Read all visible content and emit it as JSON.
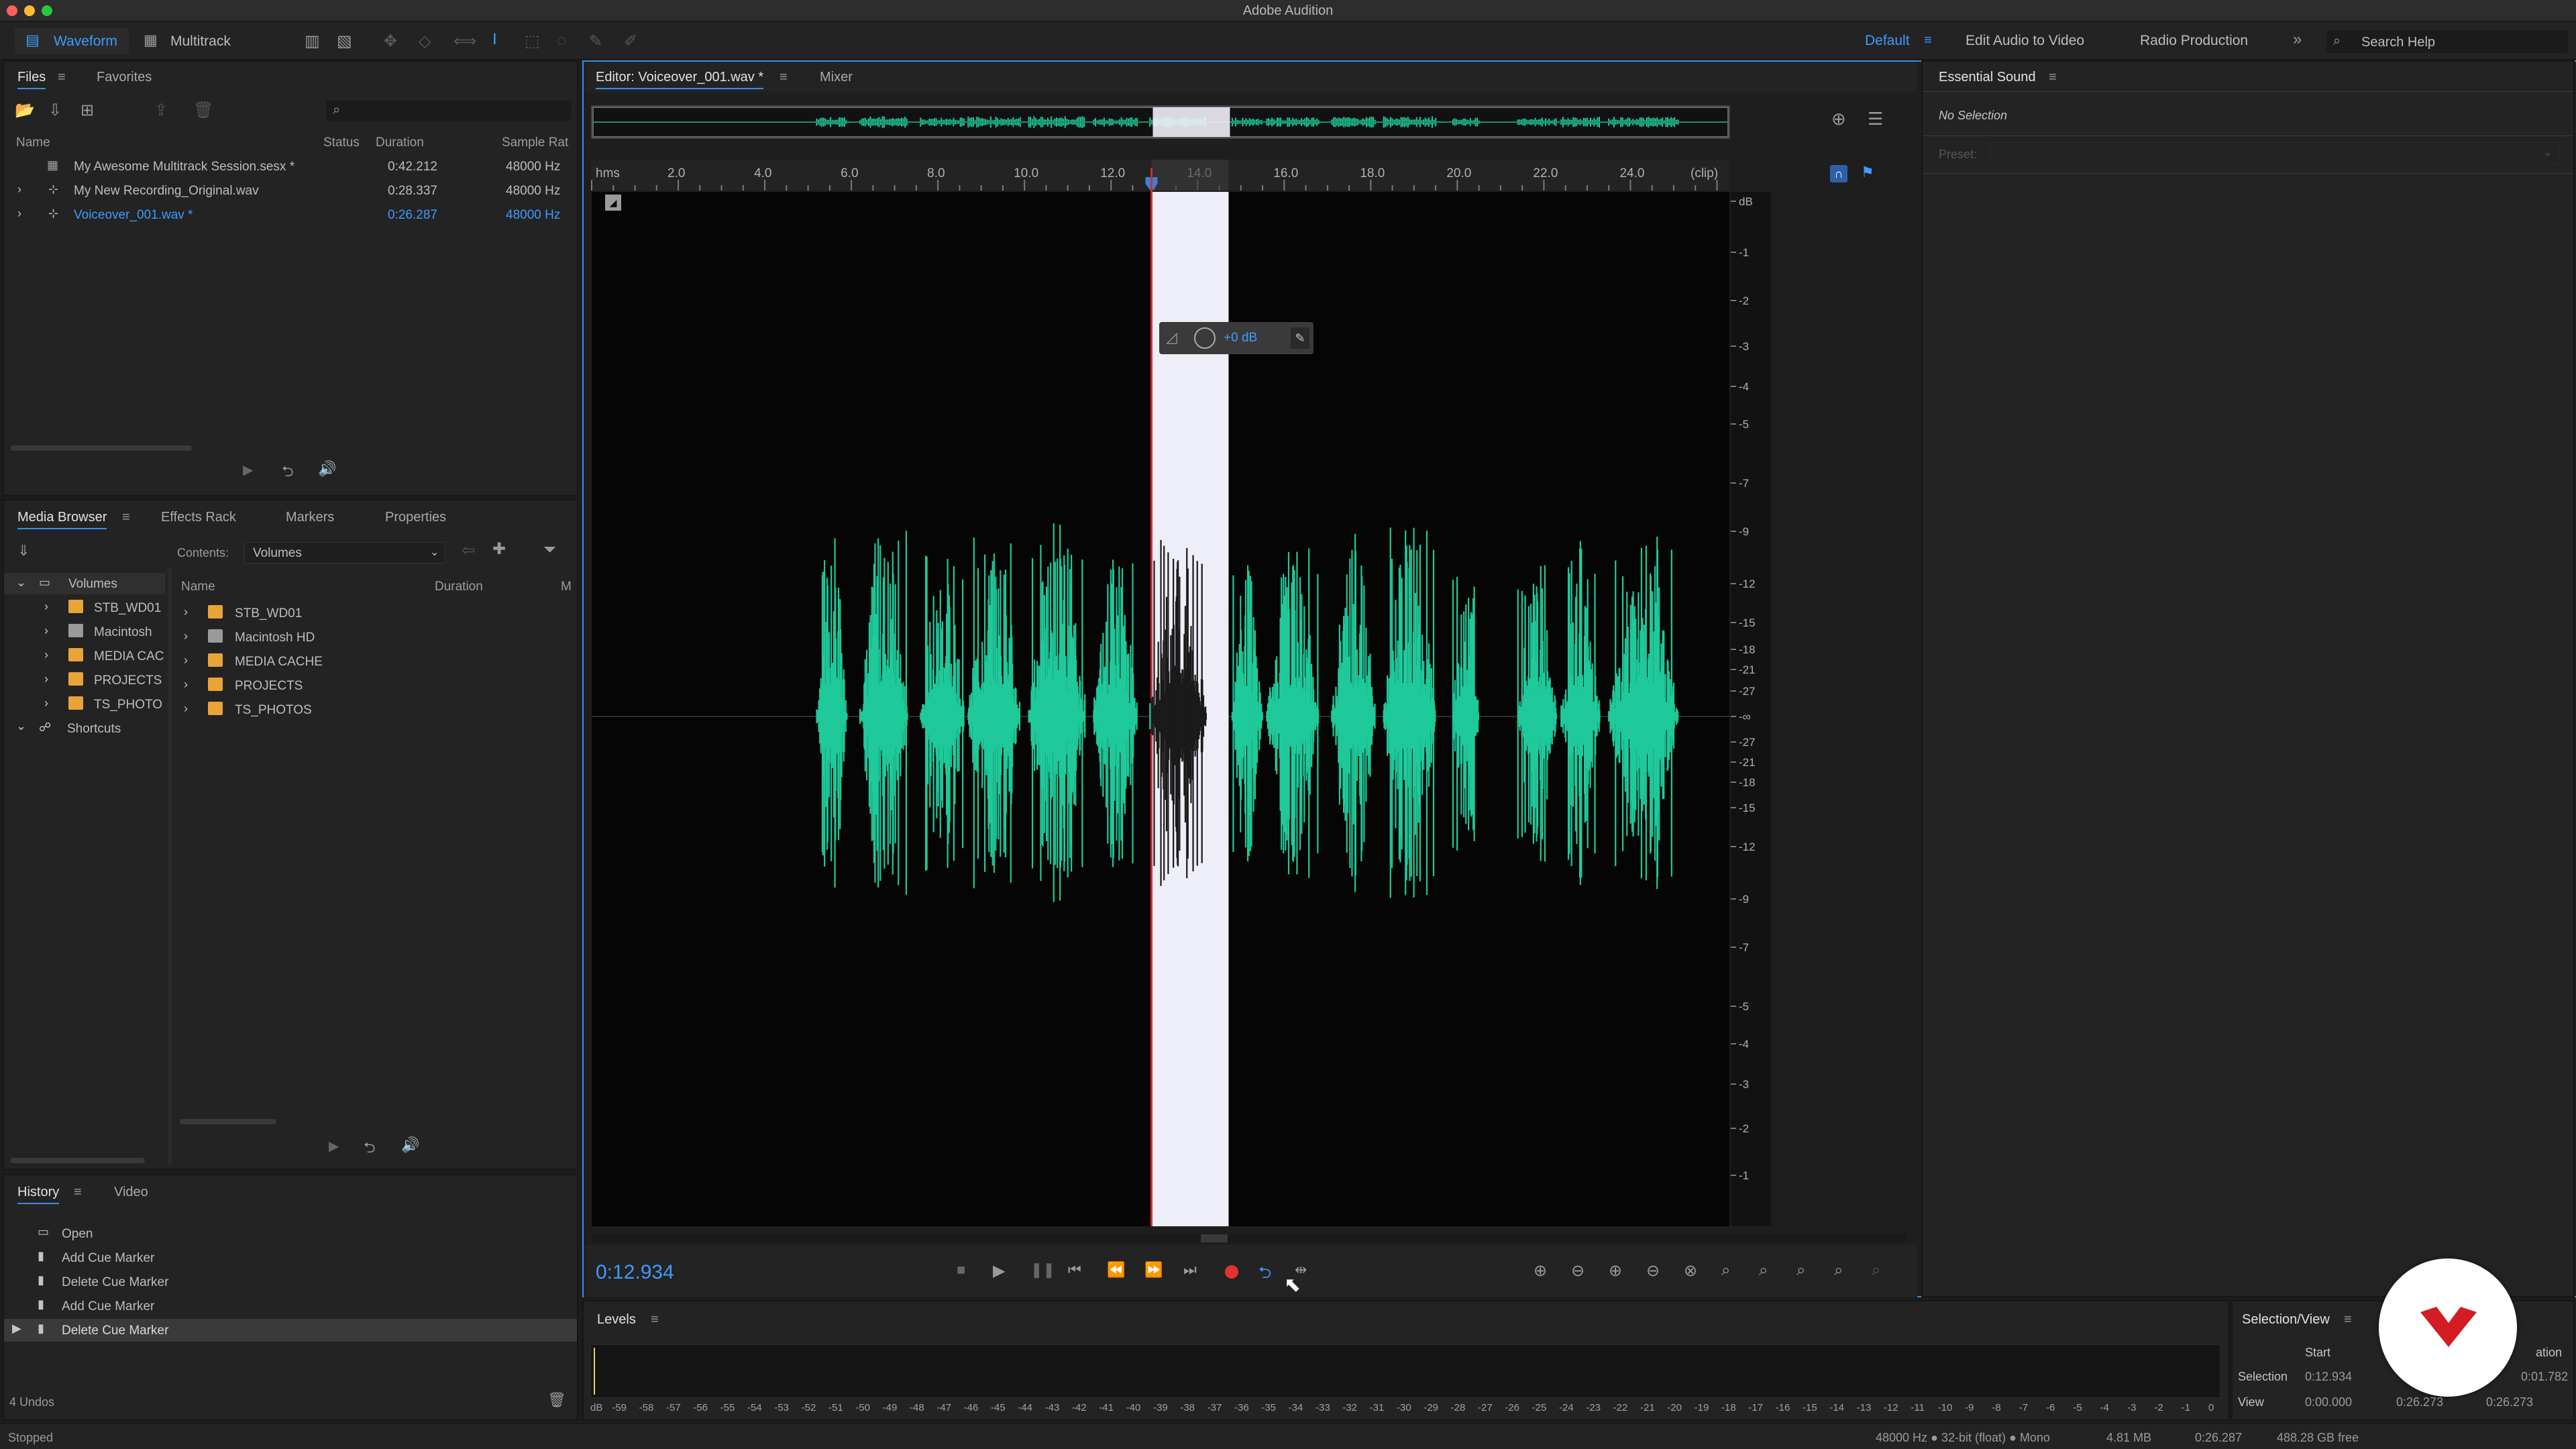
{
  "app": {
    "title": "Adobe Audition"
  },
  "toolbar": {
    "waveform_label": "Waveform",
    "multitrack_label": "Multitrack",
    "workspaces": [
      "Default",
      "Edit Audio to Video",
      "Radio Production"
    ],
    "search_placeholder": "Search Help"
  },
  "files_panel": {
    "tabs": [
      "Files",
      "Favorites"
    ],
    "columns": [
      "Name",
      "Status",
      "Duration",
      "Sample Rat"
    ],
    "rows": [
      {
        "name": "My Awesome Multitrack Session.sesx *",
        "duration": "0:42.212",
        "rate": "48000 Hz"
      },
      {
        "name": "My New Recording_Original.wav",
        "duration": "0:28.337",
        "rate": "48000 Hz"
      },
      {
        "name": "Voiceover_001.wav *",
        "duration": "0:26.287",
        "rate": "48000 Hz"
      }
    ]
  },
  "media_panel": {
    "tabs": [
      "Media Browser",
      "Effects Rack",
      "Markers",
      "Properties"
    ],
    "contents_label": "Contents:",
    "contents_value": "Volumes",
    "tree": [
      "Volumes",
      "STB_WD01",
      "Macintosh",
      "MEDIA CAC",
      "PROJECTS",
      "TS_PHOTO",
      "Shortcuts"
    ],
    "columns": [
      "Name",
      "Duration",
      "M"
    ],
    "items": [
      "STB_WD01",
      "Macintosh HD",
      "MEDIA CACHE",
      "PROJECTS",
      "TS_PHOTOS"
    ]
  },
  "history_panel": {
    "tabs": [
      "History",
      "Video"
    ],
    "items": [
      "Open",
      "Add Cue Marker",
      "Delete Cue Marker",
      "Add Cue Marker",
      "Delete Cue Marker"
    ],
    "undos": "4 Undos"
  },
  "status": {
    "left": "Stopped",
    "format": "48000 Hz ● 32-bit (float) ● Mono",
    "size": "4.81 MB",
    "duration": "0:26.287",
    "free": "488.28 GB free"
  },
  "editor": {
    "tab": "Editor: Voiceover_001.wav *",
    "mixer_tab": "Mixer",
    "hud_db": "+0 dB",
    "current_time": "0:12.934",
    "ruler": [
      "hms",
      "2.0",
      "4.0",
      "6.0",
      "8.0",
      "10.0",
      "12.0",
      "14.0",
      "16.0",
      "18.0",
      "20.0",
      "22.0",
      "24.0",
      "(clip)"
    ],
    "db_scale": [
      "dB",
      "-1",
      "-2",
      "-3",
      "-4",
      "-5",
      "-7",
      "-9",
      "-12",
      "-15",
      "-18",
      "-21",
      "-27",
      "-∞",
      "-27",
      "-21",
      "-18",
      "-15",
      "-12",
      "-9",
      "-7",
      "-5",
      "-4",
      "-3",
      "-2",
      "-1"
    ],
    "selection_start_sec": 12.934,
    "selection_end_sec": 14.716,
    "duration_sec": 26.287
  },
  "essential_sound": {
    "title": "Essential Sound",
    "no_selection": "No Selection",
    "preset_label": "Preset:"
  },
  "levels": {
    "title": "Levels",
    "scale": [
      "dB",
      "-59",
      "-58",
      "-57",
      "-56",
      "-55",
      "-54",
      "-53",
      "-52",
      "-51",
      "-50",
      "-49",
      "-48",
      "-47",
      "-46",
      "-45",
      "-44",
      "-43",
      "-42",
      "-41",
      "-40",
      "-39",
      "-38",
      "-37",
      "-36",
      "-35",
      "-34",
      "-33",
      "-32",
      "-31",
      "-30",
      "-29",
      "-28",
      "-27",
      "-26",
      "-25",
      "-24",
      "-23",
      "-22",
      "-21",
      "-20",
      "-19",
      "-18",
      "-17",
      "-16",
      "-15",
      "-14",
      "-13",
      "-12",
      "-11",
      "-10",
      "-9",
      "-8",
      "-7",
      "-6",
      "-5",
      "-4",
      "-3",
      "-2",
      "-1",
      "0"
    ]
  },
  "selection_view": {
    "title": "Selection/View",
    "start_label": "Start",
    "end_label": "ation",
    "selection_label": "Selection",
    "view_label": "View",
    "selection_start": "0:12.934",
    "selection_duration": "0:01.782",
    "view_start": "0:00.000",
    "view_end": "0:26.273",
    "view_duration": "0:26.273"
  },
  "colors": {
    "accent": "#3a8ce8",
    "waveform": "#1fc99a",
    "selection": "#eeeef8",
    "playhead": "#c83030",
    "record": "#e23333",
    "badge": "#d31c24"
  }
}
